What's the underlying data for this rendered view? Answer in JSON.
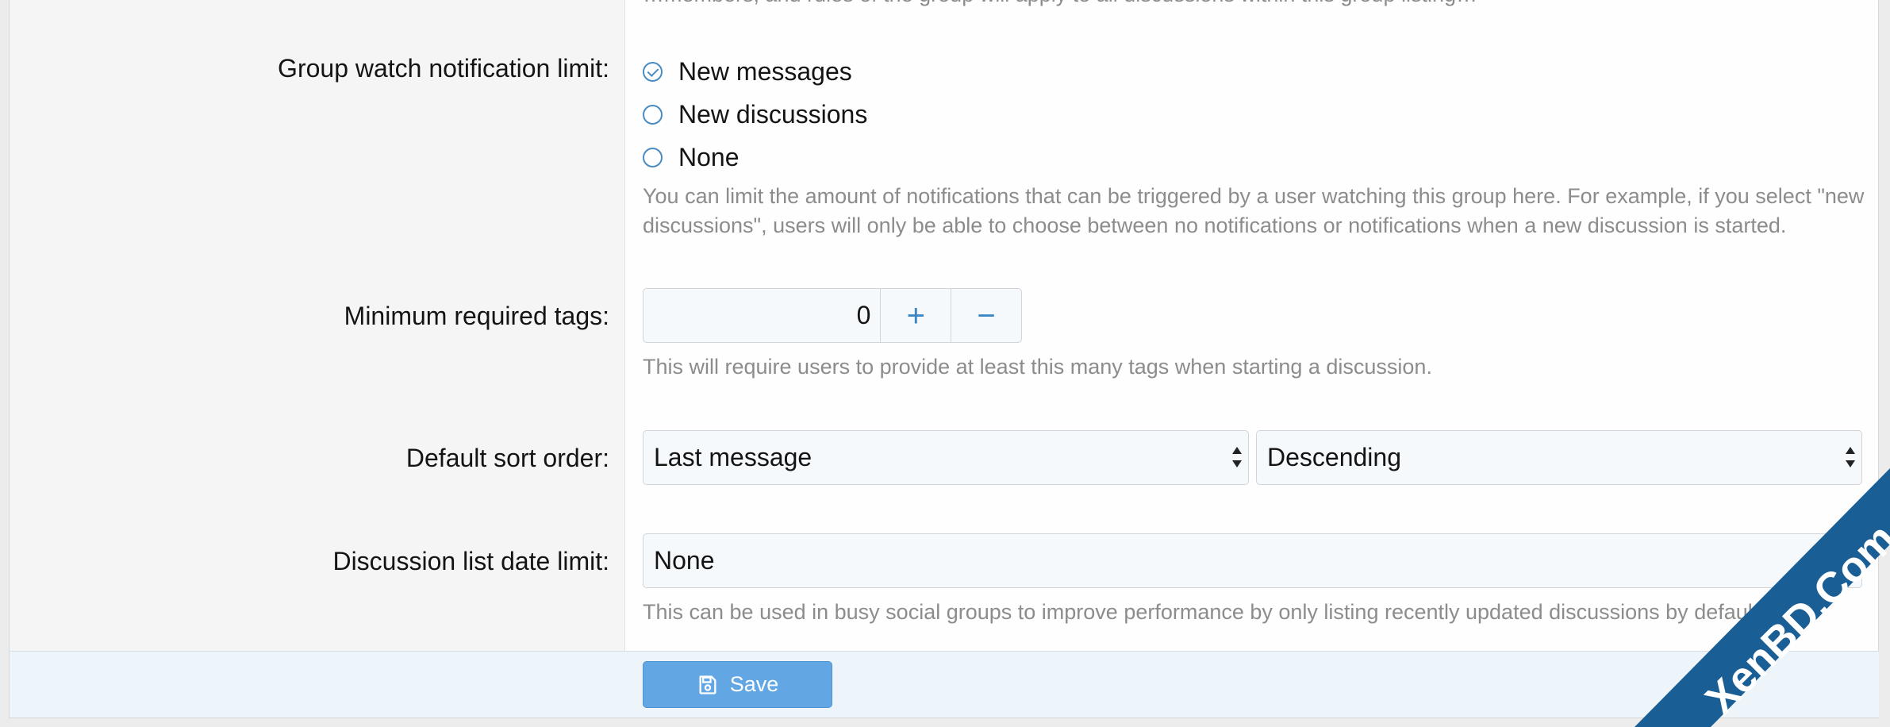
{
  "top_partial_text": "…members, and rules of the group will apply to all discussions within this group listing…",
  "group_watch": {
    "label": "Group watch notification limit:",
    "options": [
      {
        "label": "New messages",
        "checked": true
      },
      {
        "label": "New discussions",
        "checked": false
      },
      {
        "label": "None",
        "checked": false
      }
    ],
    "hint_line1": "You can limit the amount of notifications that can be triggered by a user watching this group here. For example, if you select \"new",
    "hint_line2": "discussions\", users will only be able to choose between no notifications or notifications when a new discussion is started."
  },
  "min_tags": {
    "label": "Minimum required tags:",
    "value": "0",
    "plus": "+",
    "minus": "−",
    "hint": "This will require users to provide at least this many tags when starting a discussion."
  },
  "sort_order": {
    "label": "Default sort order:",
    "field_value": "Last message",
    "direction_value": "Descending"
  },
  "date_limit": {
    "label": "Discussion list date limit:",
    "value": "None",
    "hint": "This can be used in busy social groups to improve performance by only listing recently updated discussions by default."
  },
  "footer": {
    "save_label": "Save"
  },
  "watermark": {
    "text": "XenBD.Com",
    "color": "#1a5e96"
  },
  "colors": {
    "accent": "#4a8cc2",
    "save_button": "#62a7e3",
    "hint": "#8c8c8c"
  }
}
